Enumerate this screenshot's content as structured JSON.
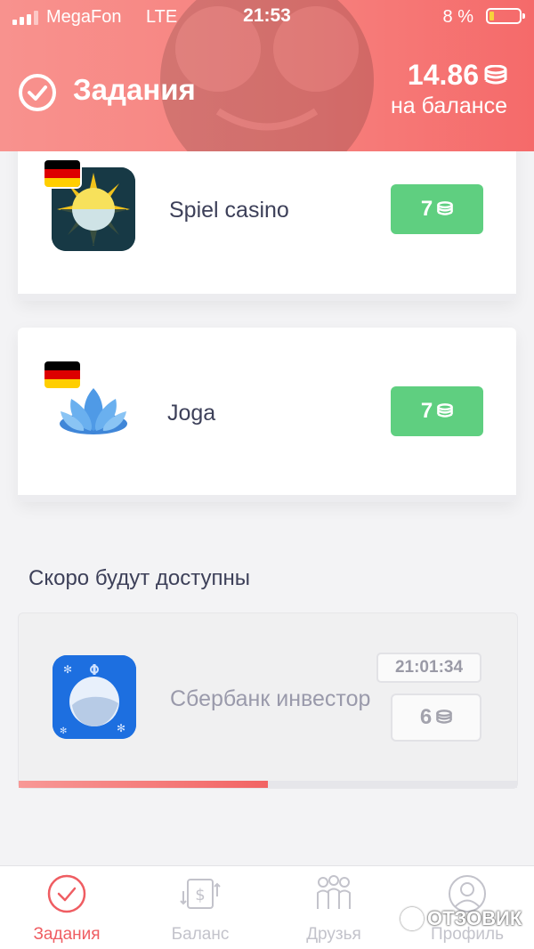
{
  "status_bar": {
    "carrier": "MegaFon",
    "network": "LTE",
    "time": "21:53",
    "battery_percent": "8 %"
  },
  "header": {
    "title": "Задания",
    "balance_amount": "14.86",
    "balance_label": "на балансе"
  },
  "tasks": [
    {
      "name": "Spiel casino",
      "reward": "7",
      "flag": "germany-flag"
    },
    {
      "name": "Joga",
      "reward": "7",
      "flag": "germany-flag"
    }
  ],
  "coming_soon": {
    "section_title": "Скоро будут доступны",
    "items": [
      {
        "name": "Сбербанк инвестор",
        "timer": "21:01:34",
        "reward": "6",
        "progress": 0.5
      }
    ]
  },
  "bottom_nav": [
    {
      "label": "Задания",
      "icon": "check-circle-icon",
      "active": true
    },
    {
      "label": "Баланс",
      "icon": "exchange-dollar-icon",
      "active": false
    },
    {
      "label": "Друзья",
      "icon": "friends-icon",
      "active": false
    },
    {
      "label": "Профиль",
      "icon": "profile-icon",
      "active": false
    }
  ],
  "watermark": "ОТЗОВИК",
  "colors": {
    "header_accent": "#f67f7c",
    "reward_green": "#5fcf80",
    "active_nav": "#ef5d62",
    "battery_low": "#f7d23b"
  }
}
